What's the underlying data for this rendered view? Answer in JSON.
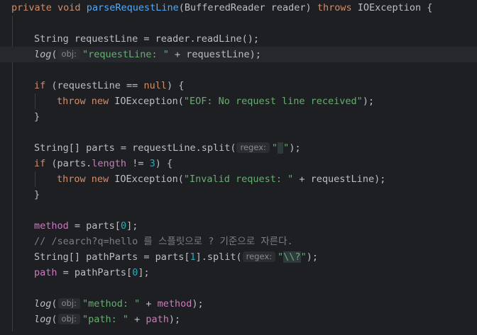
{
  "code": {
    "kw_private": "private",
    "kw_void": "void",
    "method_name": "parseRequestLine",
    "params": "(BufferedReader reader) ",
    "kw_throws": "throws",
    "sig_tail": " IOException {",
    "l3_text": "String requestLine = reader.readLine();",
    "call_log": "log",
    "paren_open": "(",
    "hint_obj": "obj:",
    "hint_regex": "regex:",
    "l4_str": "\"requestLine: \"",
    "l4_tail": " + requestLine);",
    "kw_if": "if",
    "l6_mid": " (requestLine == ",
    "kw_null": "null",
    "l6_tail": ") {",
    "kw_throw": "throw",
    "kw_new": "new",
    "l7_mid": " IOException(",
    "l7_str": "\"EOF: No request line received\"",
    "l7_tail": ");",
    "close_brace": "}",
    "l10_head": "String[] parts = requestLine.split(",
    "l10_quote1": "\"",
    "l10_space": " ",
    "l10_quote2": "\"",
    "l10_tail": ");",
    "l11_mid": " (parts.",
    "field_length": "length",
    "l11_op": " != ",
    "num_3": "3",
    "l11_tail": ") {",
    "l12_str": "\"Invalid request: \"",
    "l12_tail": " + requestLine);",
    "field_method": "method",
    "l15_mid": " = parts[",
    "num_0": "0",
    "l15_tail": "];",
    "comment": "// /search?q=hello 를 스플릿으로 ? 기준으로 자른다.",
    "l17_head": "String[] pathParts = parts[",
    "num_1": "1",
    "l17_mid": "].split(",
    "l17_quote1": "\"",
    "l17_regex": "\\\\?",
    "l17_quote2": "\"",
    "l17_tail": ");",
    "field_path": "path",
    "l18_mid": " = pathParts[",
    "l18_tail": "];",
    "l20_str": "\"method: \"",
    "l20_plus": " + ",
    "l20_tail": ");",
    "l21_str": "\"path: \"",
    "l21_plus": " + ",
    "l21_tail": ");"
  },
  "colors": {
    "background": "#1e1f22",
    "keyword": "#cf8e6d",
    "method": "#56a8f5",
    "field": "#c77dbb",
    "string": "#6aab73",
    "number": "#2aacb8",
    "comment": "#7a7e85"
  }
}
